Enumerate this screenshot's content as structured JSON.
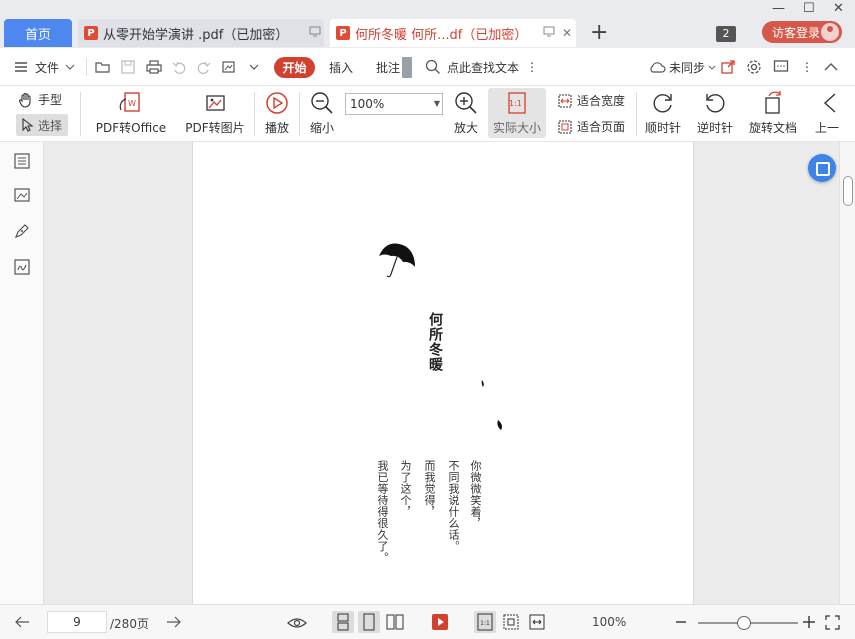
{
  "tabs": {
    "home_label": "首页",
    "doc1_title": "从零开始学演讲 .pdf（已加密）",
    "doc2_title": "何所冬暖 何所...df（已加密）",
    "pdf_badge": "P",
    "add_glyph": "+",
    "close_glyph": "✕"
  },
  "window": {
    "count_badge": "2",
    "login_label": "访客登录",
    "minimize": "—",
    "maximize": "☐",
    "close": "✕"
  },
  "menu": {
    "file_label": "文件",
    "start_label": "开始",
    "insert_label": "插入",
    "annotate_label": "批注",
    "search_label": "点此查找文本",
    "sync_label": "未同步",
    "more_glyph": "⋮"
  },
  "ribbon": {
    "hand_label": "手型",
    "select_label": "选择",
    "pdf_to_office_label": "PDF转Office",
    "pdf_to_image_label": "PDF转图片",
    "play_label": "播放",
    "zoom_out_label": "缩小",
    "zoom_value": "100%",
    "zoom_in_label": "放大",
    "actual_size_label": "实际大小",
    "actual_size_icon_text": "1:1",
    "fit_width_label": "适合宽度",
    "fit_page_label": "适合页面",
    "clockwise_label": "顺时针",
    "counterclockwise_label": "逆时针",
    "rotate_doc_label": "旋转文档",
    "prev_label": "上一"
  },
  "document": {
    "title": "何所冬暖",
    "lines": [
      "你微微笑着，",
      "不同我说什么话。",
      "而我觉得，",
      "为了这个，",
      "我已等待得很久了。"
    ]
  },
  "statusbar": {
    "current_page": "9",
    "total_pages": "/280页",
    "zoom_value": "100%"
  },
  "icons": {
    "accent": "#4e87ee",
    "brand_red": "#d24130",
    "float_button": "#3d84e8"
  }
}
